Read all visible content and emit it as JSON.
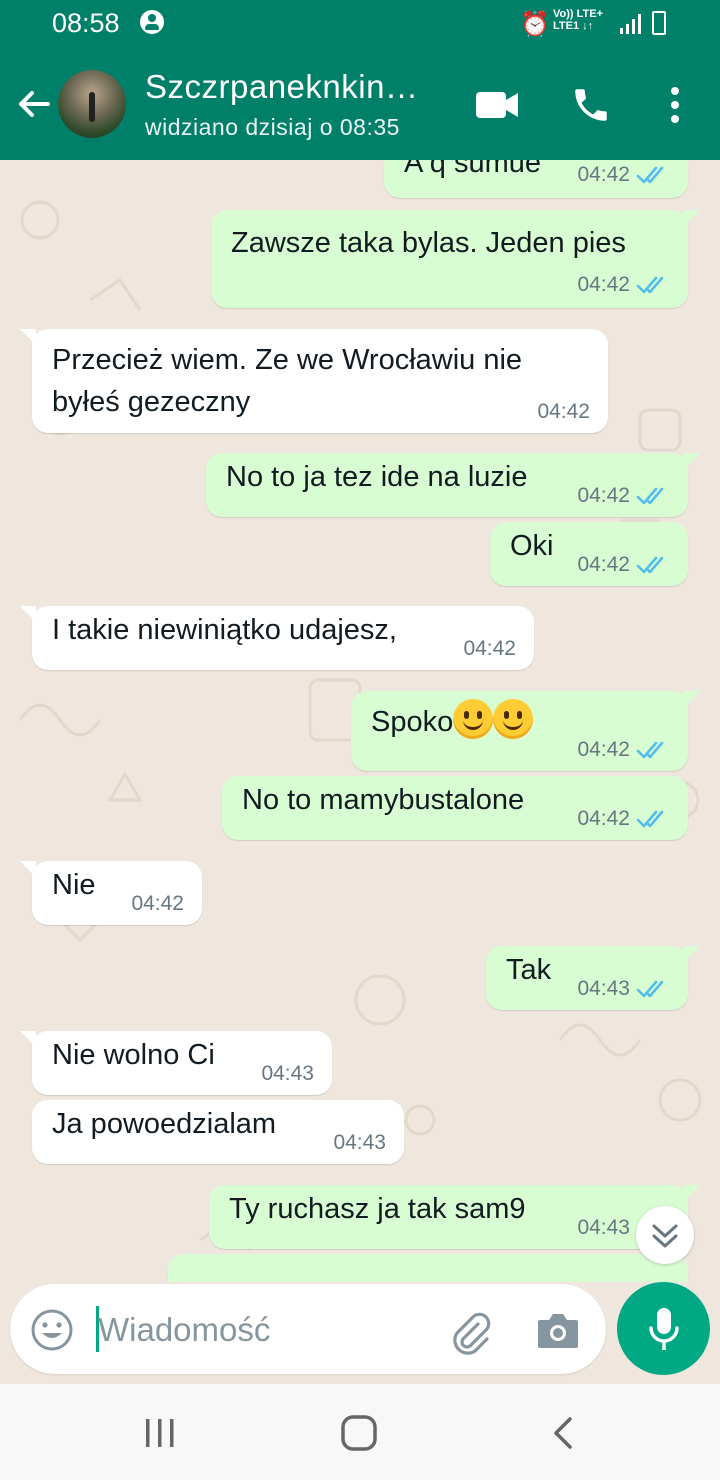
{
  "status_bar": {
    "time": "08:58",
    "network_line1": "Vo)) LTE+",
    "network_line2": "LTE1 ↓↑"
  },
  "header": {
    "contact_name": "Szczrpaneknkin…",
    "last_seen": "widziano dzisiaj o 08:35",
    "icons": [
      "back-arrow-icon",
      "avatar",
      "video-call-icon",
      "voice-call-icon",
      "more-vert-icon"
    ]
  },
  "messages": [
    {
      "dir": "out",
      "text": "A q sumue",
      "time": "04:42",
      "read": true
    },
    {
      "dir": "out",
      "text": "Zawsze taka bylas. Jeden pies",
      "time": "04:42",
      "read": true
    },
    {
      "dir": "in",
      "line1": "Przecież wiem. Ze we Wrocławiu nie",
      "line2": "byłeś gezeczny",
      "time": "04:42"
    },
    {
      "dir": "out",
      "text": "No to ja tez ide na luzie",
      "time": "04:42",
      "read": true
    },
    {
      "dir": "out",
      "text": "Oki",
      "time": "04:42",
      "read": true
    },
    {
      "dir": "in",
      "text": "I takie niewiniątko udajesz,",
      "time": "04:42"
    },
    {
      "dir": "out",
      "text": "Spoko",
      "emoji": "🙂🙂",
      "time": "04:42",
      "read": true
    },
    {
      "dir": "out",
      "text": "No to mamybustalone",
      "time": "04:42",
      "read": true
    },
    {
      "dir": "in",
      "text": "Nie",
      "time": "04:42"
    },
    {
      "dir": "out",
      "text": "Tak",
      "time": "04:43",
      "read": true
    },
    {
      "dir": "in",
      "text": "Nie wolno Ci",
      "time": "04:43"
    },
    {
      "dir": "in",
      "text": "Ja powoedzialam",
      "time": "04:43"
    },
    {
      "dir": "out",
      "text": "Ty ruchasz ja tak sam9",
      "time": "04:43",
      "read": true
    }
  ],
  "composer": {
    "placeholder": "Wiadomość",
    "icons": [
      "emoji-icon",
      "attach-icon",
      "camera-icon",
      "mic-icon"
    ]
  },
  "colors": {
    "header": "#008069",
    "outgoing_bubble": "#d9fdd3",
    "incoming_bubble": "#ffffff",
    "chat_background": "#efe7dd",
    "read_ticks": "#53bdeb",
    "accent": "#00a884"
  }
}
